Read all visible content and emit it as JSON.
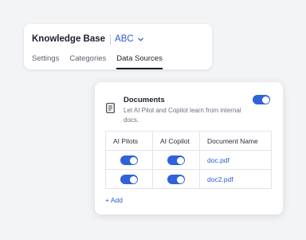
{
  "header": {
    "title": "Knowledge Base",
    "workspace": "ABC"
  },
  "tabs": [
    {
      "label": "Settings",
      "active": false
    },
    {
      "label": "Categories",
      "active": false
    },
    {
      "label": "Data Sources",
      "active": true
    }
  ],
  "documents_section": {
    "title": "Documents",
    "description": "Let AI Pilot and Copilot learn from internal docs.",
    "enabled": true,
    "icon": "document-icon",
    "table": {
      "columns": [
        "AI Pilots",
        "AI Copilot",
        "Document Name"
      ],
      "rows": [
        {
          "ai_pilot": true,
          "ai_copilot": true,
          "name": "doc.pdf"
        },
        {
          "ai_pilot": true,
          "ai_copilot": true,
          "name": "doc2.pdf"
        }
      ]
    },
    "add_label": "+ Add"
  },
  "colors": {
    "accent": "#2f63db",
    "link": "#2d5bd3",
    "background": "#f3f4f6"
  }
}
